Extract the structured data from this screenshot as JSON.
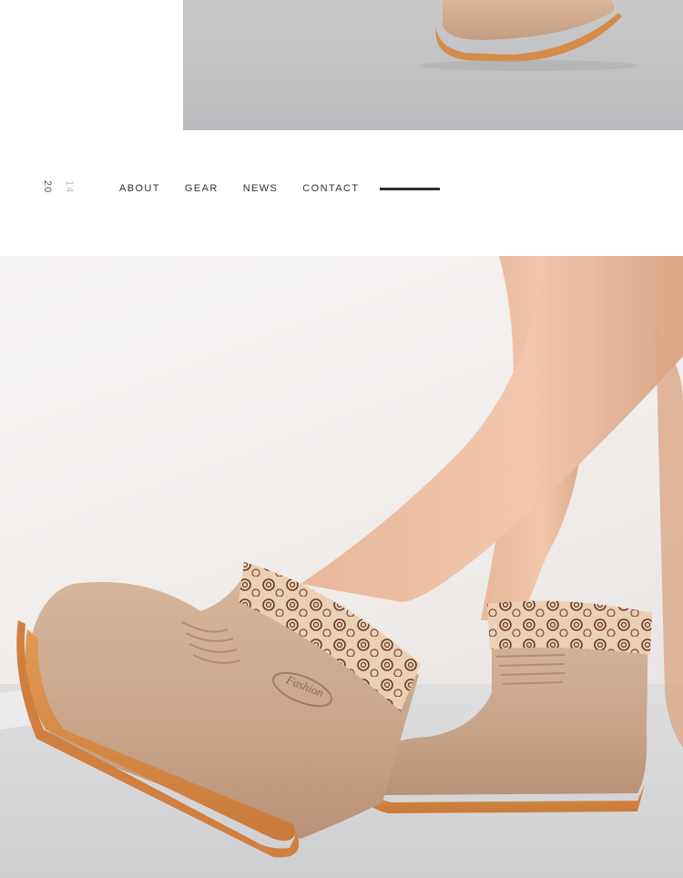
{
  "page": {
    "year_part1": "20",
    "year_part2": "14"
  },
  "nav": {
    "items": [
      {
        "label": "ABOUT"
      },
      {
        "label": "GEAR"
      },
      {
        "label": "NEWS"
      },
      {
        "label": "CONTACT"
      }
    ]
  },
  "product": {
    "logo_text": "Fashion"
  },
  "colors": {
    "boot_body": "#c9a88d",
    "sole": "#d98a45",
    "cuff": "#e7c7a6",
    "cuff_pattern": "#6b3a2b",
    "background": "#ffffff",
    "nav_text": "#333333"
  }
}
